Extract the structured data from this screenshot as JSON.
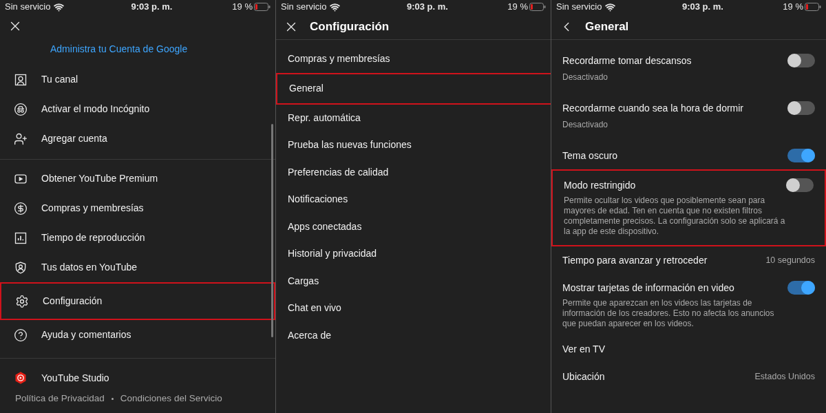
{
  "panels": [
    {
      "kind": "account_menu",
      "status_bar": {
        "carrier": "Sin servicio",
        "time": "9:03 p. m.",
        "battery": "19 %"
      },
      "manage_account_link": "Administra tu Cuenta de Google",
      "groups": [
        {
          "items": [
            {
              "label": "Tu canal",
              "highlighted": false
            },
            {
              "label": "Activar el modo Incógnito",
              "highlighted": false
            },
            {
              "label": "Agregar cuenta",
              "highlighted": false
            }
          ]
        },
        {
          "items": [
            {
              "label": "Obtener YouTube Premium",
              "highlighted": false
            },
            {
              "label": "Compras y membresías",
              "highlighted": false
            },
            {
              "label": "Tiempo de reproducción",
              "highlighted": false
            },
            {
              "label": "Tus datos en YouTube",
              "highlighted": false
            },
            {
              "label": "Configuración",
              "highlighted": true
            },
            {
              "label": "Ayuda y comentarios",
              "highlighted": false
            }
          ]
        },
        {
          "items": [
            {
              "label": "YouTube Studio",
              "highlighted": false
            }
          ]
        }
      ],
      "footer_links": [
        "Política de Privacidad",
        "Condiciones del Servicio"
      ]
    },
    {
      "kind": "settings_list",
      "status_bar": {
        "carrier": "Sin servicio",
        "time": "9:03 p. m.",
        "battery": "19 %"
      },
      "title": "Configuración",
      "items": [
        {
          "label": "Compras y membresías",
          "highlighted": false
        },
        {
          "label": "General",
          "highlighted": true
        },
        {
          "label": "Repr. automática",
          "highlighted": false
        },
        {
          "label": "Prueba las nuevas funciones",
          "highlighted": false
        },
        {
          "label": "Preferencias de calidad",
          "highlighted": false
        },
        {
          "label": "Notificaciones",
          "highlighted": false
        },
        {
          "label": "Apps conectadas",
          "highlighted": false
        },
        {
          "label": "Historial y privacidad",
          "highlighted": false
        },
        {
          "label": "Cargas",
          "highlighted": false
        },
        {
          "label": "Chat en vivo",
          "highlighted": false
        },
        {
          "label": "Acerca de",
          "highlighted": false
        }
      ]
    },
    {
      "kind": "general_settings",
      "status_bar": {
        "carrier": "Sin servicio",
        "time": "9:03 p. m.",
        "battery": "19 %"
      },
      "title": "General",
      "items": [
        {
          "kind": "toggle",
          "label": "Recordarme tomar descansos",
          "subtitle": "Desactivado",
          "on": false,
          "highlighted": false
        },
        {
          "kind": "toggle",
          "label": "Recordarme cuando sea la hora de dormir",
          "subtitle": "Desactivado",
          "on": false,
          "highlighted": false
        },
        {
          "kind": "toggle",
          "label": "Tema oscuro",
          "on": true,
          "highlighted": false
        },
        {
          "kind": "toggle",
          "label": "Modo restringido",
          "description": "Permite ocultar los videos que posiblemente sean para mayores de edad. Ten en cuenta que no existen filtros completamente precisos. La configuración solo se aplicará a la app de este dispositivo.",
          "on": false,
          "highlighted": true
        },
        {
          "kind": "value",
          "label": "Tiempo para avanzar y retroceder",
          "value": "10 segundos",
          "highlighted": false
        },
        {
          "kind": "toggle",
          "label": "Mostrar tarjetas de información en video",
          "description": "Permite que aparezcan en los videos las tarjetas de información de los creadores. Esto no afecta los anuncios que puedan aparecer en los videos.",
          "on": true,
          "highlighted": false
        },
        {
          "kind": "link",
          "label": "Ver en TV",
          "highlighted": false
        },
        {
          "kind": "value",
          "label": "Ubicación",
          "value": "Estados Unidos",
          "highlighted": false
        }
      ]
    }
  ]
}
